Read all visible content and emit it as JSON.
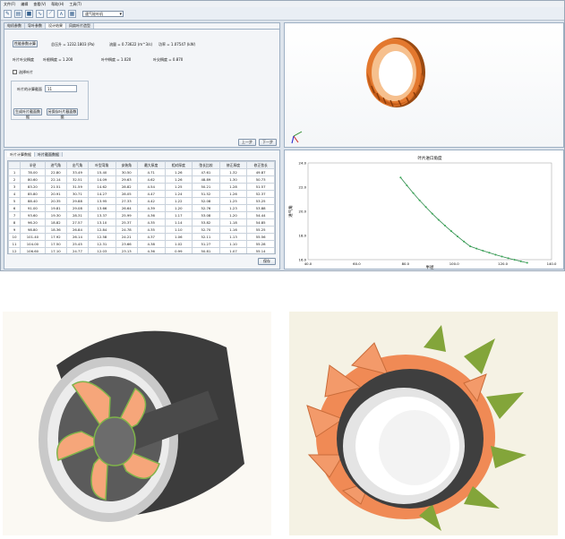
{
  "menu": [
    "文件(F)",
    "编辑",
    "查看(V)",
    "帮助(H)",
    "工具(T)"
  ],
  "toolbar": {
    "select_value": "速气轮叶机"
  },
  "left_tabs": [
    "电机参数",
    "导叶参数",
    "设计结果",
    "风扇叶片造型"
  ],
  "params": {
    "btn_calc": "性能参数计算",
    "total_pressure": "总压升 = 1232.1803 (Pa)",
    "flow": "流量 = 0.73622 (m^3/s)",
    "power": "功率 = 1.07547 (kW)",
    "solidity": "叶片叶尖稠度",
    "hub_ratio": "叶根稠度 = 1.200",
    "mid_ratio": "叶中稠度 = 1.020",
    "tip_ratio": "叶尖稠度 = 0.870",
    "checkbox": "选择叶片",
    "count_label": "叶片的计算截面",
    "count_value": "11",
    "btn_gen": "生成叶片截面数据",
    "btn_save": "另保存叶片截面数据",
    "prev": "上一步",
    "next": "下一步"
  },
  "table_tabs": [
    "叶片计算数据",
    "叶片截面数据"
  ],
  "table": {
    "headers": [
      "",
      "半径",
      "进气角",
      "出气角",
      "叶型弯角",
      "安装角",
      "最大厚度",
      "相对厚度",
      "弦长比较",
      "修正厚度",
      "修正弦长"
    ],
    "rows": [
      [
        "1",
        "78.00",
        "22.80",
        "33.49",
        "15.40",
        "30.50",
        "4.71",
        "1.26",
        "47.61",
        "1.32",
        "49.87"
      ],
      [
        "2",
        "80.60",
        "22.14",
        "32.51",
        "14.09",
        "29.63",
        "4.62",
        "1.26",
        "48.89",
        "1.30",
        "50.73"
      ],
      [
        "3",
        "83.20",
        "21.51",
        "31.59",
        "14.62",
        "28.82",
        "4.54",
        "1.25",
        "50.21",
        "1.28",
        "51.57"
      ],
      [
        "4",
        "85.80",
        "20.91",
        "30.71",
        "14.27",
        "28.05",
        "4.47",
        "1.24",
        "51.52",
        "1.26",
        "52.37"
      ],
      [
        "5",
        "88.40",
        "20.35",
        "29.88",
        "13.95",
        "27.33",
        "4.42",
        "1.22",
        "52.08",
        "1.25",
        "53.25"
      ],
      [
        "6",
        "91.00",
        "19.81",
        "29.08",
        "13.66",
        "26.64",
        "4.39",
        "1.20",
        "52.76",
        "1.23",
        "53.88"
      ],
      [
        "7",
        "93.60",
        "19.30",
        "28.31",
        "13.37",
        "25.99",
        "4.36",
        "1.17",
        "53.08",
        "1.20",
        "54.44"
      ],
      [
        "8",
        "96.20",
        "18.82",
        "27.57",
        "13.10",
        "25.37",
        "4.35",
        "1.14",
        "53.82",
        "1.18",
        "54.85"
      ],
      [
        "9",
        "98.80",
        "18.36",
        "26.84",
        "12.84",
        "24.78",
        "4.35",
        "1.10",
        "52.70",
        "1.16",
        "55.25"
      ],
      [
        "10",
        "101.40",
        "17.92",
        "26.14",
        "12.58",
        "24.21",
        "4.37",
        "1.06",
        "52.11",
        "1.13",
        "55.56"
      ],
      [
        "11",
        "104.00",
        "17.50",
        "25.45",
        "12.31",
        "23.66",
        "4.38",
        "1.02",
        "51.27",
        "1.10",
        "55.28"
      ],
      [
        "12",
        "106.60",
        "17.10",
        "24.77",
        "12.03",
        "23.13",
        "4.36",
        "0.99",
        "50.81",
        "1.07",
        "55.14"
      ]
    ]
  },
  "save_btn": "保存",
  "chart_data": {
    "type": "line",
    "title": "叶片进口角度",
    "xlabel": "半径",
    "ylabel": "进气角",
    "xlim": [
      40,
      140
    ],
    "ylim": [
      16,
      24
    ],
    "x_ticks": [
      "40.0",
      "60.0",
      "80.0",
      "100.0",
      "120.0",
      "140.0"
    ],
    "y_ticks": [
      "16.0",
      "18.0",
      "20.0",
      "22.0",
      "24.0"
    ],
    "x": [
      78.0,
      80.6,
      83.2,
      85.8,
      88.4,
      91.0,
      93.6,
      96.2,
      98.8,
      101.4,
      104.0,
      106.6,
      109.2,
      111.8,
      114.4,
      117.0,
      119.6,
      122.2,
      124.8,
      127.4,
      130.0
    ],
    "y": [
      22.8,
      22.14,
      21.51,
      20.91,
      20.35,
      19.81,
      19.3,
      18.82,
      18.36,
      17.92,
      17.5,
      17.1,
      16.92,
      16.74,
      16.57,
      16.41,
      16.26,
      16.12,
      15.99,
      15.86,
      15.74
    ]
  }
}
